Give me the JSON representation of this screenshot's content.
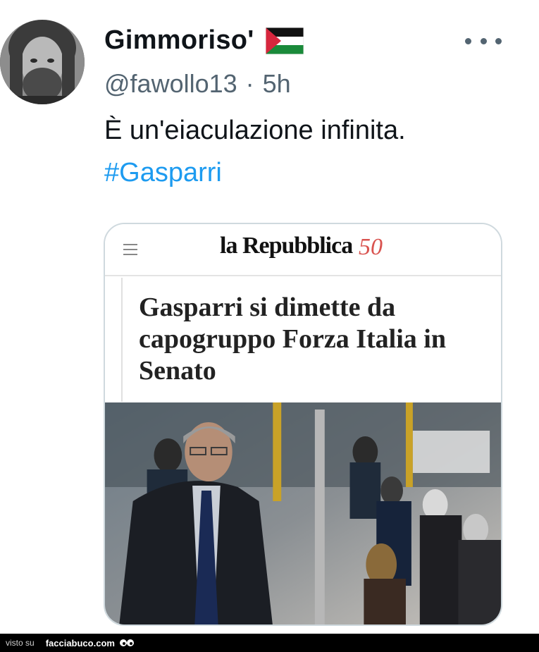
{
  "tweet": {
    "display_name": "Gimmoriso'",
    "flag_icon": "palestine-flag-icon",
    "handle": "@fawollo13",
    "separator": "·",
    "time": "5h",
    "text": "È un'eiaculazione infinita.",
    "hashtag": "#Gasparri",
    "more_icon": "more-options-icon"
  },
  "card": {
    "brand": "la Repubblica",
    "brand_suffix": "50",
    "headline": "Gasparri si dimette da capogruppo Forza Italia in Senato",
    "menu_icon": "hamburger-menu-icon"
  },
  "footer": {
    "prefix": "visto su",
    "site": "facciabuco.com"
  },
  "colors": {
    "hashtag": "#1d9bf0",
    "secondary_text": "#536471",
    "card_border": "#cfd9de",
    "footer_bg": "#000000"
  }
}
